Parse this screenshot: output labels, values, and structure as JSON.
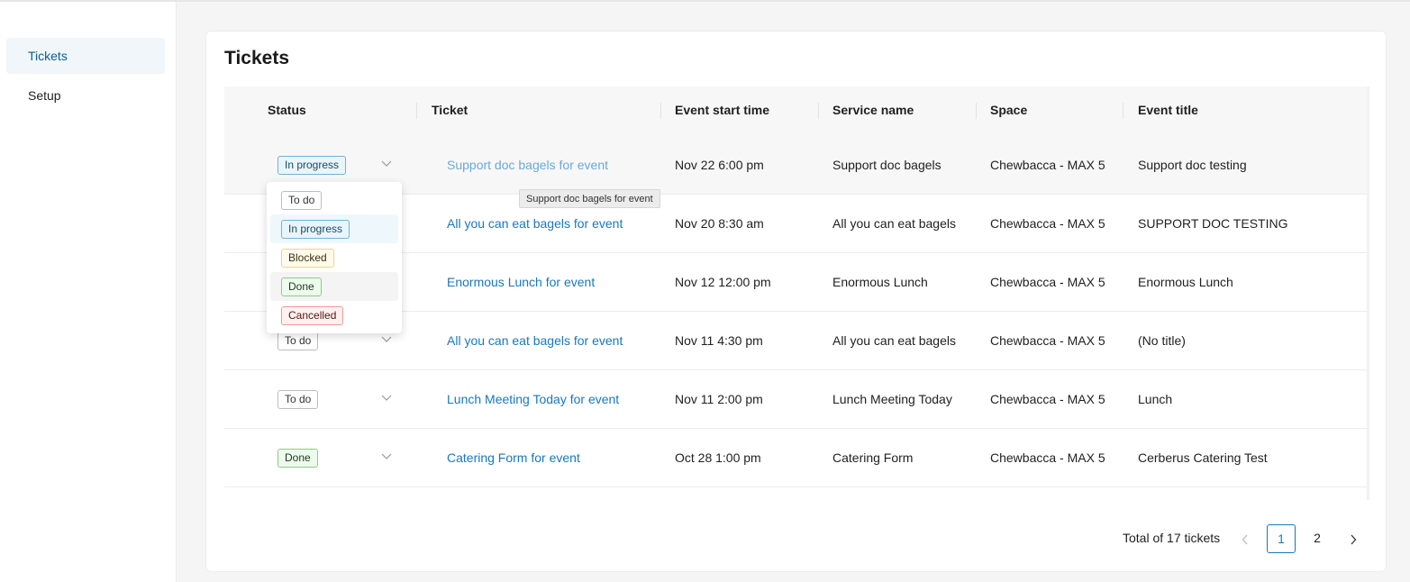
{
  "sidebar": {
    "items": [
      {
        "label": "Tickets",
        "active": true
      },
      {
        "label": "Setup",
        "active": false
      }
    ]
  },
  "page_title": "Tickets",
  "table": {
    "columns": [
      "Status",
      "Ticket",
      "Event start time",
      "Service name",
      "Space",
      "Event title"
    ],
    "rows": [
      {
        "status": "In progress",
        "ticket": "Support doc bagels for event",
        "start": "Nov 22 6:00 pm",
        "service": "Support doc bagels",
        "space": "Chewbacca - MAX 5",
        "title": "Support doc testing"
      },
      {
        "status": "",
        "ticket": "All you can eat bagels for event",
        "start": "Nov 20 8:30 am",
        "service": "All you can eat bagels",
        "space": "Chewbacca - MAX 5",
        "title": "SUPPORT DOC TESTING"
      },
      {
        "status": "",
        "ticket": "Enormous Lunch for event",
        "start": "Nov 12 12:00 pm",
        "service": "Enormous Lunch",
        "space": "Chewbacca - MAX 5",
        "title": "Enormous Lunch"
      },
      {
        "status": "To do",
        "ticket": "All you can eat bagels for event",
        "start": "Nov 11 4:30 pm",
        "service": "All you can eat bagels",
        "space": "Chewbacca - MAX 5",
        "title": "(No title)"
      },
      {
        "status": "To do",
        "ticket": "Lunch Meeting Today for event",
        "start": "Nov 11 2:00 pm",
        "service": "Lunch Meeting Today",
        "space": "Chewbacca - MAX 5",
        "title": "Lunch"
      },
      {
        "status": "Done",
        "ticket": "Catering Form for event",
        "start": "Oct 28 1:00 pm",
        "service": "Catering Form",
        "space": "Chewbacca - MAX 5",
        "title": "Cerberus Catering Test"
      }
    ]
  },
  "status_dropdown": {
    "options": [
      "To do",
      "In progress",
      "Blocked",
      "Done",
      "Cancelled"
    ],
    "selected": "In progress",
    "hovered": "Done"
  },
  "tooltip": "Support doc bagels for event",
  "pagination": {
    "total_text": "Total of 17 tickets",
    "pages": [
      "1",
      "2"
    ],
    "current": "1"
  },
  "colors": {
    "accent": "#1a78b7",
    "todo": "#bdbdbd",
    "in_progress": "#73b3d3",
    "blocked": "#f1d389",
    "done": "#89cf82",
    "cancelled": "#ec9a95"
  },
  "icons": [
    "chevron-down-icon",
    "chevron-left-icon",
    "chevron-right-icon"
  ]
}
